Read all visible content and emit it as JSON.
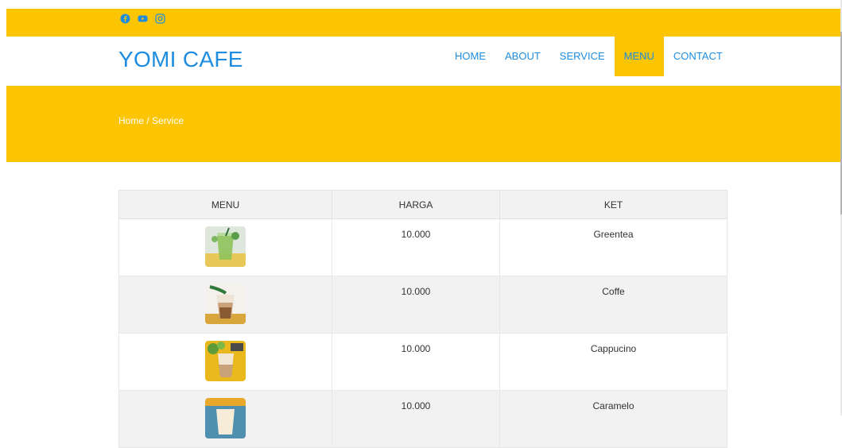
{
  "topbar": {
    "social": [
      "facebook-icon",
      "youtube-icon",
      "instagram-icon"
    ]
  },
  "header": {
    "brand": "YOMI CAFE",
    "nav": [
      "HOME",
      "ABOUT",
      "SERVICE",
      "MENU",
      "CONTACT"
    ],
    "active": "MENU"
  },
  "hero": {
    "breadcrumb": "Home / Service"
  },
  "table": {
    "headers": [
      "MENU",
      "HARGA",
      "KET"
    ],
    "rows": [
      {
        "image": "greentea-drink-image",
        "harga": "10.000",
        "ket": "Greentea"
      },
      {
        "image": "coffee-drink-image",
        "harga": "10.000",
        "ket": "Coffe"
      },
      {
        "image": "cappuccino-drink-image",
        "harga": "10.000",
        "ket": "Cappucino"
      },
      {
        "image": "caramel-drink-image",
        "harga": "10.000",
        "ket": "Caramelo"
      }
    ]
  },
  "colors": {
    "accent": "#fcc503",
    "brand": "#1e8de0"
  }
}
